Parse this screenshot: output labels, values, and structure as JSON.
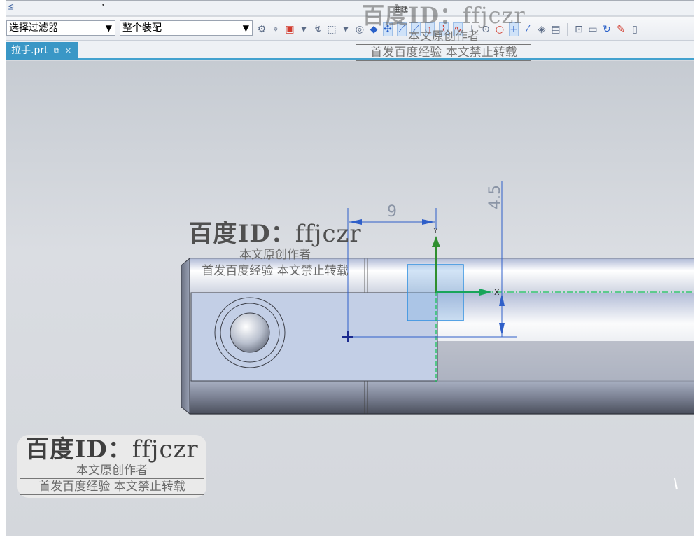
{
  "topstrip": {
    "left_label": "⊴",
    "group_label": "曲线"
  },
  "toolbar": {
    "filter_value": "选择过滤器",
    "assembly_value": "整个装配",
    "dropdown_glyph": "▼"
  },
  "tab": {
    "file_name": "拉手.prt",
    "pin_glyph": "⧉",
    "close_glyph": "×"
  },
  "dimensions": {
    "horizontal": "9",
    "vertical": "4.5"
  },
  "axes": {
    "x_label": "X",
    "y_label": "Y"
  },
  "watermark": {
    "brand": "百度ID：",
    "user_id": "ffjczr",
    "line1": "本文原创作者",
    "line2": "首发百度经验  本文禁止转载"
  },
  "colors": {
    "accent": "#3a97c6",
    "dimension": "#2f5fc9",
    "x_axis": "#18a55a",
    "y_axis": "#2f8f2f",
    "selection_box": "#2e8fe0"
  }
}
